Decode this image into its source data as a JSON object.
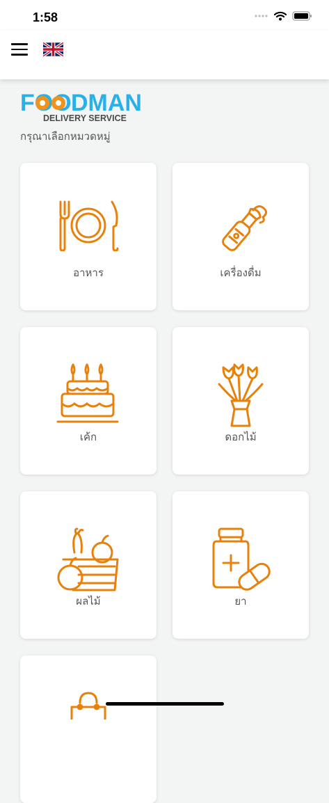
{
  "status_bar": {
    "time": "1:58"
  },
  "header": {
    "menu_icon": "hamburger-menu-icon",
    "language_flag": "uk-flag-icon"
  },
  "logo": {
    "text_foo": "FOO",
    "text_dman": "DMAN",
    "tagline": "DELIVERY SERVICE"
  },
  "subtitle": "กรุณาเลือกหมวดหมู่",
  "categories": [
    {
      "label": "อาหาร",
      "icon": "plate-fork-knife-icon"
    },
    {
      "label": "เครื่องดื่ม",
      "icon": "bottle-icon"
    },
    {
      "label": "เค้ก",
      "icon": "cake-icon"
    },
    {
      "label": "ดอกไม้",
      "icon": "flower-bouquet-icon"
    },
    {
      "label": "ผลไม้",
      "icon": "fruit-basket-icon"
    },
    {
      "label": "ยา",
      "icon": "medicine-icon"
    },
    {
      "label": "",
      "icon": "shopping-bag-icon"
    }
  ],
  "colors": {
    "accent": "#e8800c",
    "logo_blue": "#2ab0e8",
    "logo_orange": "#f0931e",
    "tagline": "#4a4a4a"
  }
}
